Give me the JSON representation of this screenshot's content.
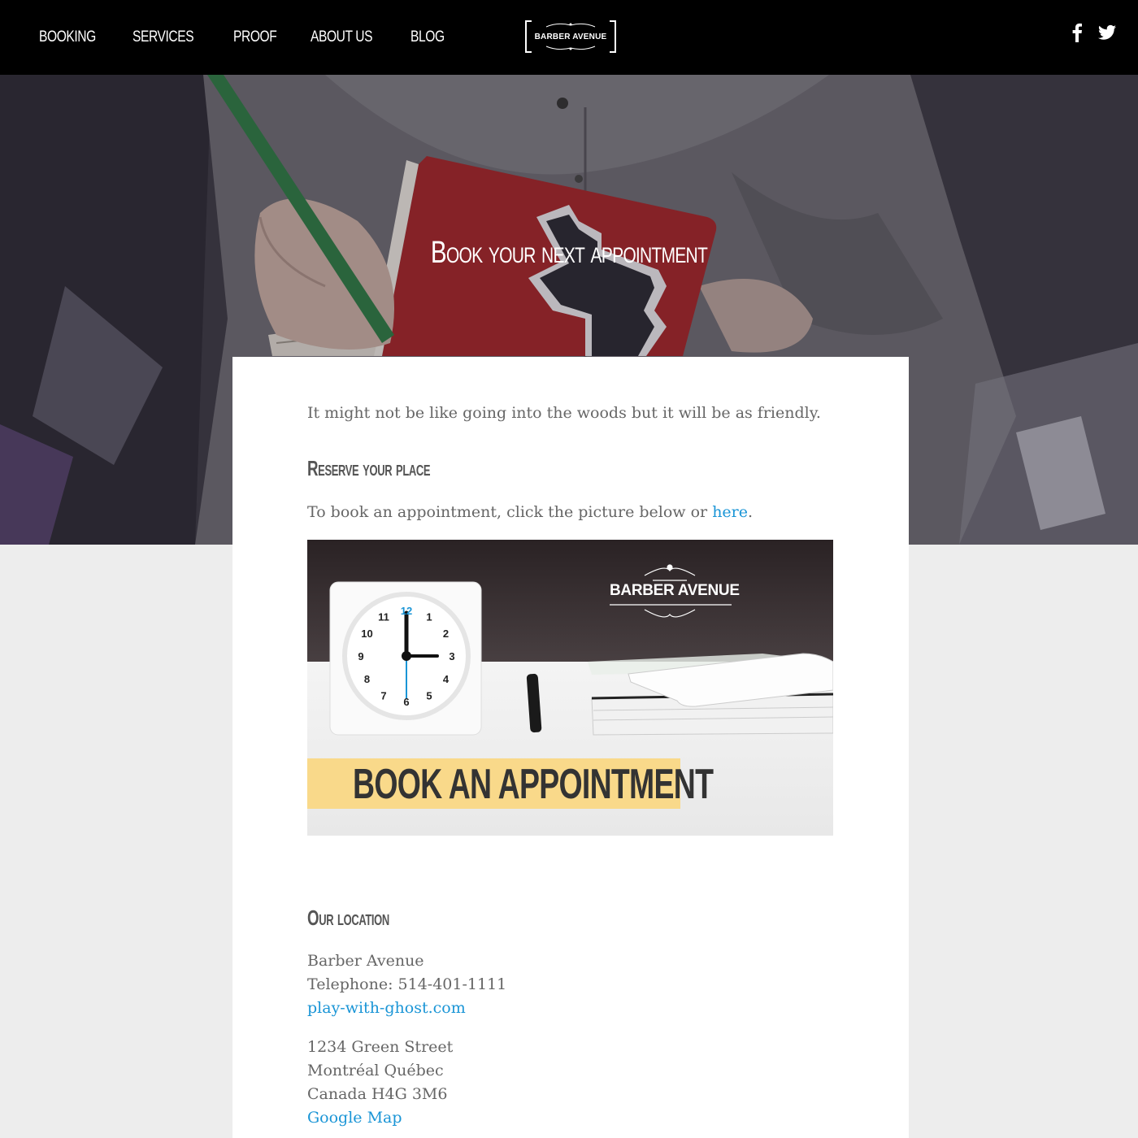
{
  "nav": {
    "links": [
      "BOOKING",
      "SERVICES",
      "PROOF",
      "ABOUT US",
      "BLOG"
    ],
    "logo_text": "BARBER AVENUE",
    "social": [
      "facebook-icon",
      "twitter-icon"
    ]
  },
  "hero": {
    "title": "Book your next appointment"
  },
  "content": {
    "intro": "It might not be like going into the woods but it will be as friendly.",
    "reserve_heading": "Reserve your place",
    "reserve_text_before": "To book an appointment, click the picture below or ",
    "reserve_link": "here",
    "reserve_text_after": ".",
    "banner": {
      "logo_text": "BARBER AVENUE",
      "cta": "BOOK AN APPOINTMENT",
      "clock_numbers": [
        "12",
        "1",
        "2",
        "3",
        "4",
        "5",
        "6",
        "7",
        "8",
        "9",
        "10",
        "11"
      ]
    },
    "location_heading": "Our location",
    "business_name": "Barber Avenue",
    "telephone": "Telephone: 514-401-1111",
    "website_link": "play-with-ghost.com",
    "address_line1": "1234 Green Street",
    "address_line2": "Montréal Québec",
    "address_line3": "Canada H4G 3M6",
    "map_link": "Google Map"
  },
  "colors": {
    "nav_bg": "#000000",
    "link": "#1a95d6",
    "cta_bg": "#f9d98a",
    "page_bg": "#ededed"
  }
}
